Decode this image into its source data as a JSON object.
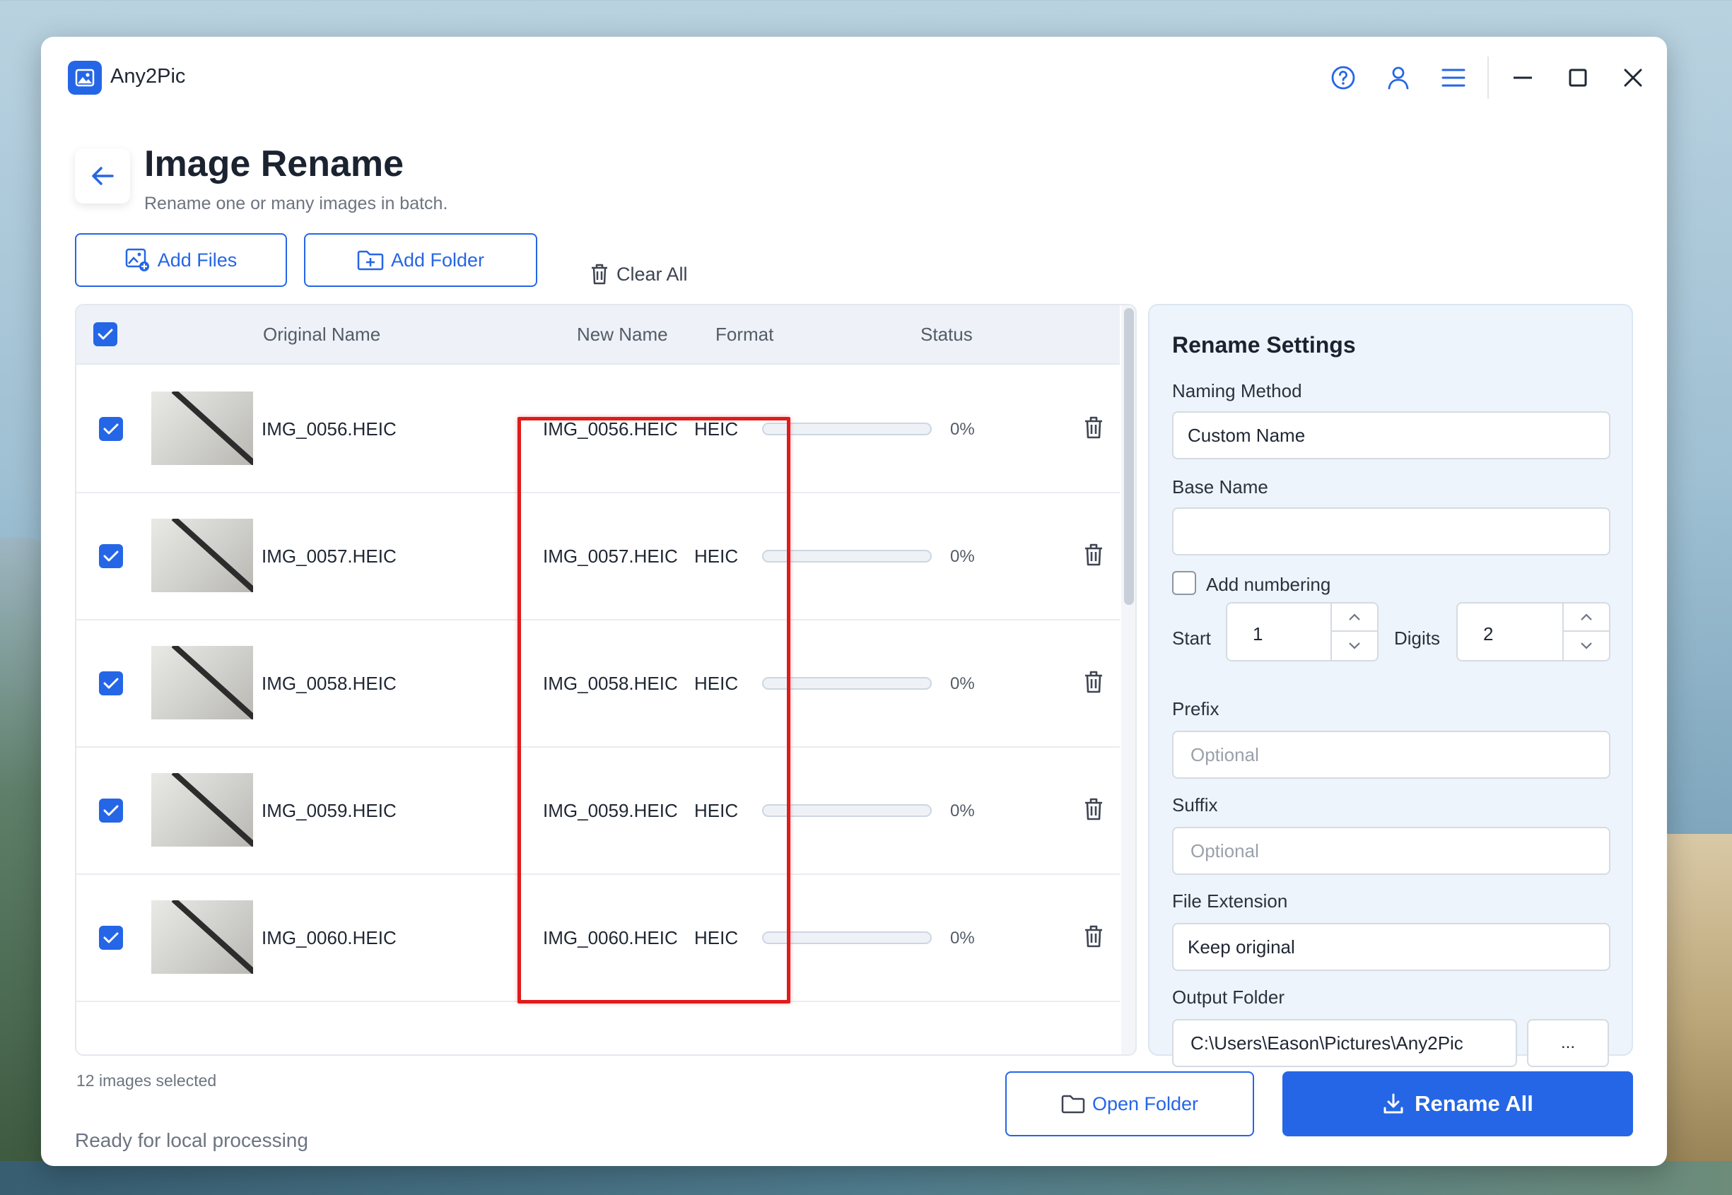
{
  "app": {
    "name": "Any2Pic"
  },
  "header": {
    "title": "Image Rename",
    "subtitle": "Rename one or many images in batch."
  },
  "toolbar": {
    "add_files": "Add Files",
    "add_folder": "Add Folder",
    "clear_all": "Clear All"
  },
  "table": {
    "columns": {
      "original": "Original Name",
      "new": "New Name",
      "format": "Format",
      "status": "Status"
    },
    "rows": [
      {
        "original": "IMG_0056.HEIC",
        "new": "IMG_0056.HEIC",
        "format": "HEIC",
        "progress": 0,
        "percent": "0%"
      },
      {
        "original": "IMG_0057.HEIC",
        "new": "IMG_0057.HEIC",
        "format": "HEIC",
        "progress": 0,
        "percent": "0%"
      },
      {
        "original": "IMG_0058.HEIC",
        "new": "IMG_0058.HEIC",
        "format": "HEIC",
        "progress": 0,
        "percent": "0%"
      },
      {
        "original": "IMG_0059.HEIC",
        "new": "IMG_0059.HEIC",
        "format": "HEIC",
        "progress": 0,
        "percent": "0%"
      },
      {
        "original": "IMG_0060.HEIC",
        "new": "IMG_0060.HEIC",
        "format": "HEIC",
        "progress": 0,
        "percent": "0%"
      }
    ]
  },
  "footer": {
    "selected_count": "12 images selected",
    "status": "Ready for local processing",
    "open_folder": "Open Folder",
    "rename_all": "Rename All"
  },
  "settings": {
    "title": "Rename Settings",
    "naming_method_label": "Naming Method",
    "naming_method_value": "Custom Name",
    "base_name_label": "Base Name",
    "base_name_value": "",
    "add_numbering_label": "Add numbering",
    "add_numbering_checked": false,
    "start_label": "Start",
    "start_value": "1",
    "digits_label": "Digits",
    "digits_value": "2",
    "prefix_label": "Prefix",
    "prefix_placeholder": "Optional",
    "suffix_label": "Suffix",
    "suffix_placeholder": "Optional",
    "file_extension_label": "File Extension",
    "file_extension_value": "Keep original",
    "output_folder_label": "Output Folder",
    "output_folder_value": "C:\\Users\\Eason\\Pictures\\Any2Pic",
    "browse_label": "..."
  },
  "colors": {
    "accent": "#2566e6",
    "highlight": "#e01b1b"
  },
  "icons": [
    "app-logo-icon",
    "help-icon",
    "user-icon",
    "menu-icon",
    "minimize-icon",
    "maximize-icon",
    "close-icon",
    "back-arrow-icon",
    "add-image-icon",
    "add-folder-icon",
    "trash-icon",
    "folder-icon",
    "download-icon",
    "chevron-up-icon",
    "chevron-down-icon"
  ]
}
